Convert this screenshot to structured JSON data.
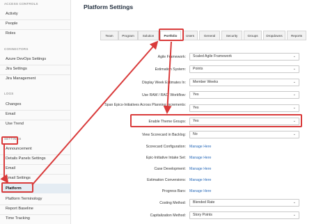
{
  "sidebar": {
    "sections": {
      "access_controls": "ACCESS CONTROLS",
      "connectors": "CONNECTORS",
      "logs": "LOGS",
      "settings": "SETTINGS"
    },
    "items": {
      "activity": "Activity",
      "people": "People",
      "roles": "Roles",
      "azure": "Azure DevOps Settings",
      "jira_settings": "Jira Settings",
      "jira_mgmt": "Jira Management",
      "changes": "Changes",
      "email_log": "Email",
      "use_trend": "Use Trend",
      "announcement": "Announcement",
      "details_panels": "Details Panels Settings",
      "email": "Email",
      "email_settings": "Email Settings",
      "platform": "Platform",
      "platform_terminology": "Platform Terminology",
      "report_baseline": "Report Baseline",
      "time_tracking": "Time Tracking"
    }
  },
  "main": {
    "title": "Platform Settings",
    "tabs": [
      "Team",
      "Program",
      "Solution",
      "Portfolio",
      "Users",
      "General",
      "Security",
      "Groups",
      "Dropdowns",
      "Reports"
    ],
    "active_tab": "Portfolio"
  },
  "settings": {
    "agile_framework": {
      "label": "Agile Framework:",
      "value": "Scaled Agile Framework"
    },
    "estimation_system": {
      "label": "Estimation System:",
      "value": "Points"
    },
    "display_week": {
      "label": "Display Week Estimates In:",
      "value": "Member Weeks"
    },
    "ram_raci": {
      "label": "Use RAM / RACI Workflow:",
      "value": "Yes"
    },
    "span_epics": {
      "label": "Span Epics-Initiatives Across Planning Increments:",
      "value": "Yes"
    },
    "enable_theme_groups": {
      "label": "Enable Theme Groups:",
      "value": "Yes"
    },
    "view_scorecard": {
      "label": "View Scorecard in Backlog:",
      "value": "No"
    },
    "scorecard_config": {
      "label": "Scorecard Configuration:",
      "value": "Manage Here"
    },
    "epic_intake": {
      "label": "Epic-Initiative Intake Set:",
      "value": "Manage Here"
    },
    "case_development": {
      "label": "Case Development:",
      "value": "Manage Here"
    },
    "estimation_conversions": {
      "label": "Estimation Conversions:",
      "value": "Manage Here"
    },
    "progress_bars": {
      "label": "Progress Bars:",
      "value": "Manage Here"
    },
    "costing_method": {
      "label": "Costing Method:",
      "value": "Blended Rate"
    },
    "capitalization_method": {
      "label": "Capitalization Method:",
      "value": "Story Points"
    }
  },
  "icons": {
    "dropdown": "chevron-down-icon"
  },
  "colors": {
    "annotation": "#d93a3a",
    "link": "#2a6ab8",
    "active_bg": "#e4ecf3"
  }
}
